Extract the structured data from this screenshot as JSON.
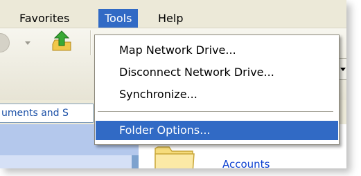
{
  "menubar": {
    "items": [
      {
        "label": "Favorites"
      },
      {
        "label": "Tools"
      },
      {
        "label": "Help"
      }
    ]
  },
  "tools_menu": {
    "items": [
      {
        "label": "Map Network Drive..."
      },
      {
        "label": "Disconnect Network Drive..."
      },
      {
        "label": "Synchronize..."
      },
      {
        "label": "Folder Options..."
      }
    ],
    "selected": "Folder Options..."
  },
  "address": {
    "value": "uments and S"
  },
  "content": {
    "folder_label": "Accounts"
  },
  "colors": {
    "highlight": "#316ac5",
    "link": "#0b3fd0"
  },
  "icons": [
    "back-icon",
    "dropdown-arrow-icon",
    "up-folder-icon",
    "folder-icon"
  ]
}
